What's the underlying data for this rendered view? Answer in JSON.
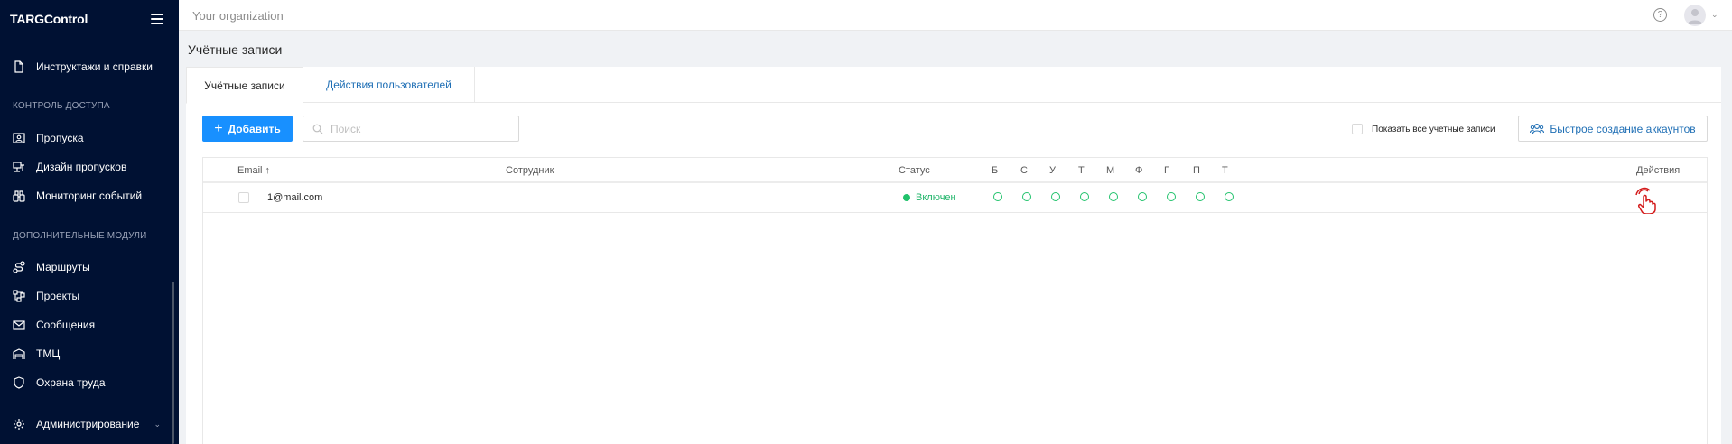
{
  "sidebar": {
    "logo": "TARGControl",
    "items_top": [
      {
        "label": "Инструктажи и справки",
        "icon": "document-icon"
      }
    ],
    "sections": [
      {
        "title": "КОНТРОЛЬ ДОСТУПА",
        "items": [
          {
            "label": "Пропуска",
            "icon": "badge-icon"
          },
          {
            "label": "Дизайн пропусков",
            "icon": "design-icon"
          },
          {
            "label": "Мониторинг событий",
            "icon": "binoculars-icon"
          }
        ]
      },
      {
        "title": "ДОПОЛНИТЕЛЬНЫЕ МОДУЛИ",
        "items": [
          {
            "label": "Маршруты",
            "icon": "route-icon"
          },
          {
            "label": "Проекты",
            "icon": "project-icon"
          },
          {
            "label": "Сообщения",
            "icon": "mail-icon"
          },
          {
            "label": "ТМЦ",
            "icon": "warehouse-icon"
          },
          {
            "label": "Охрана труда",
            "icon": "shield-icon"
          }
        ]
      }
    ],
    "admin": {
      "label": "Администрирование",
      "icon": "gear-icon",
      "chevron": "chevron-down-icon"
    }
  },
  "header": {
    "org": "Your organization",
    "help": "?"
  },
  "page": {
    "title": "Учётные записи"
  },
  "tabs": [
    {
      "label": "Учётные записи",
      "active": true
    },
    {
      "label": "Действия пользователей",
      "active": false
    }
  ],
  "toolbar": {
    "add_label": "Добавить",
    "search_placeholder": "Поиск",
    "show_all_label": "Показать все учетные записи",
    "quick_create_label": "Быстрое создание аккаунтов"
  },
  "table": {
    "columns": {
      "email": "Email ↑",
      "employee": "Сотрудник",
      "status": "Статус",
      "days": [
        "Б",
        "С",
        "У",
        "Т",
        "М",
        "Ф",
        "Г",
        "П",
        "Т"
      ],
      "actions": "Действия"
    },
    "rows": [
      {
        "email": "1@mail.com",
        "employee": "",
        "status": "Включен"
      }
    ]
  },
  "colors": {
    "sidebar_bg": "#001133",
    "primary": "#1890ff",
    "link": "#1f6fb5",
    "success": "#20c26b",
    "action_icon": "#d41c1c"
  }
}
